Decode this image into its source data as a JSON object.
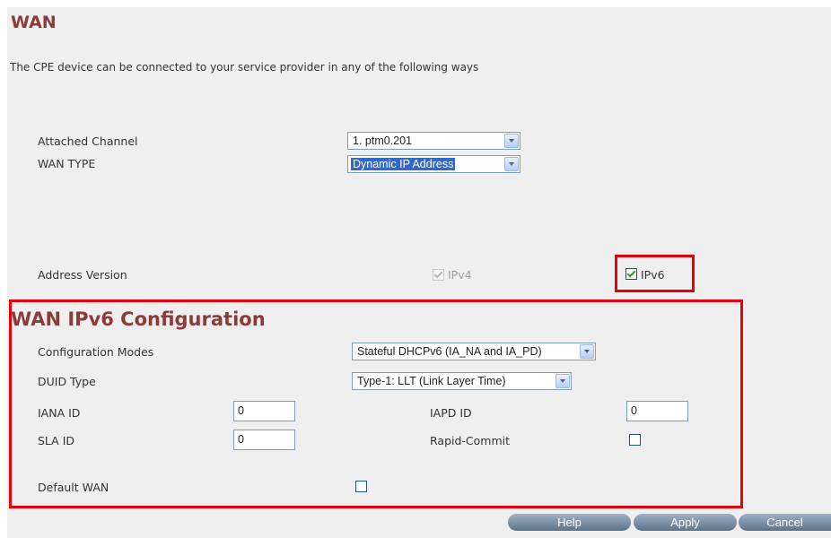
{
  "page": {
    "title": "WAN",
    "description": "The CPE device can be connected to your service provider in any of the following ways"
  },
  "wan": {
    "attached_channel_label": "Attached Channel",
    "attached_channel_value": "1. ptm0.201",
    "wan_type_label": "WAN TYPE",
    "wan_type_value": "Dynamic IP Address",
    "address_version_label": "Address Version",
    "ipv4_label": "IPv4",
    "ipv4_checked": true,
    "ipv4_disabled": true,
    "ipv6_label": "IPv6",
    "ipv6_checked": true
  },
  "ipv6_config": {
    "title": "WAN IPv6 Configuration",
    "configuration_modes_label": "Configuration Modes",
    "configuration_modes_value": "Stateful DHCPv6 (IA_NA and IA_PD)",
    "duid_type_label": "DUID Type",
    "duid_type_value": "Type-1: LLT (Link Layer Time)",
    "iana_id_label": "IANA ID",
    "iana_id_value": "0",
    "iapd_id_label": "IAPD ID",
    "iapd_id_value": "0",
    "sla_id_label": "SLA ID",
    "sla_id_value": "0",
    "rapid_commit_label": "Rapid-Commit",
    "rapid_commit_checked": false,
    "default_wan_label": "Default WAN",
    "default_wan_checked": false
  },
  "buttons": {
    "help": "Help",
    "apply": "Apply",
    "cancel": "Cancel"
  },
  "colors": {
    "title": "#8c3b3b",
    "highlight": "#e8000c",
    "background": "#efefef",
    "selected": "#3169c6"
  }
}
